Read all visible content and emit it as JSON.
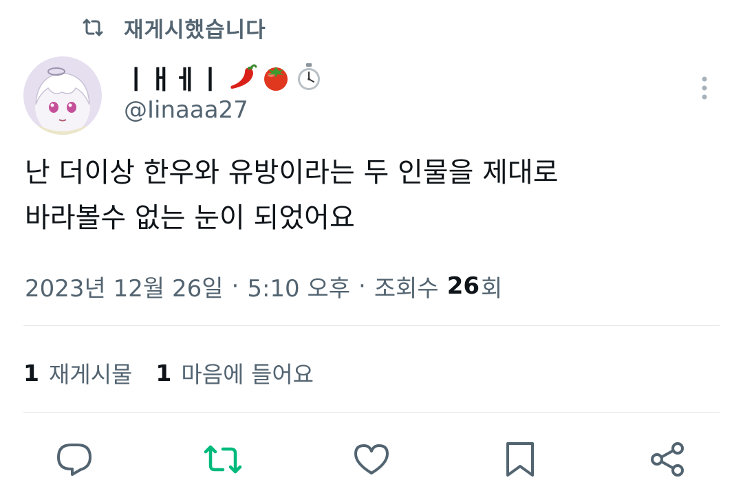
{
  "repost_banner": {
    "text": "재게시했습니다",
    "icon": "repost-icon"
  },
  "author": {
    "display_name": "ㅣㅐㅔㅣ",
    "name_emojis": [
      "chili-pepper",
      "tomato",
      "stopwatch"
    ],
    "handle": "@Iinaaa27",
    "avatar": "anime-avatar"
  },
  "tweet": {
    "lines": [
      "난 더이상 한우와 유방이라는 두 인물을 제대로",
      "바라볼수 없는 눈이 되었어요"
    ]
  },
  "meta": {
    "date": "2023년 12월 26일",
    "separator": "·",
    "time": "5:10 오후",
    "views_label": "조회수",
    "views_count": "26",
    "views_suffix": "회"
  },
  "stats": {
    "reposts": {
      "count": "1",
      "label": "재게시물"
    },
    "likes": {
      "count": "1",
      "label": "마음에 들어요"
    }
  },
  "actions": [
    {
      "name": "reply",
      "icon": "reply-icon",
      "color": "#536471"
    },
    {
      "name": "repost",
      "icon": "repost-icon",
      "color": "#00ba7c"
    },
    {
      "name": "like",
      "icon": "heart-icon",
      "color": "#536471"
    },
    {
      "name": "bookmark",
      "icon": "bookmark-icon",
      "color": "#536471"
    },
    {
      "name": "share",
      "icon": "share-icon",
      "color": "#536471"
    }
  ],
  "colors": {
    "text_primary": "#0f1419",
    "text_secondary": "#536471",
    "repost_active": "#00ba7c",
    "divider": "#e4e8eb"
  }
}
